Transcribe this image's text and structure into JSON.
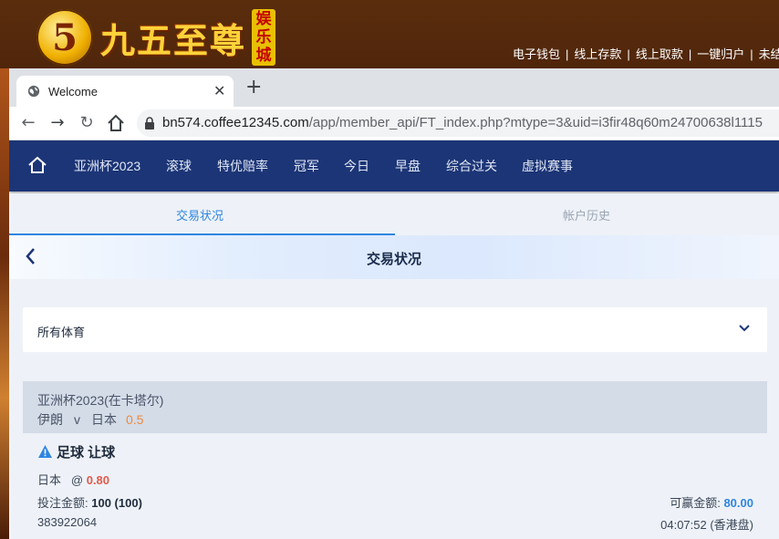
{
  "site": {
    "logo_digit": "5",
    "logo_text": "九五至尊",
    "logo_badge": [
      "娱",
      "乐",
      "城"
    ],
    "top_links": [
      "电子钱包",
      "线上存款",
      "线上取款",
      "一键归户",
      "未结"
    ]
  },
  "browser": {
    "tab_title": "Welcome",
    "url_host": "bn574.coffee12345.com",
    "url_path": "/app/member_api/FT_index.php?mtype=3&uid=i3fir48q60m24700638l1115"
  },
  "nav": {
    "items": [
      "亚洲杯2023",
      "滚球",
      "特优赔率",
      "冠军",
      "今日",
      "早盘",
      "综合过关",
      "虚拟赛事"
    ]
  },
  "subtabs": [
    "交易状况",
    "帐户历史"
  ],
  "page_title": "交易状况",
  "filter": {
    "selected": "所有体育"
  },
  "bet": {
    "league": "亚洲杯2023(在卡塔尔)",
    "home": "伊朗",
    "vs": "v",
    "away": "日本",
    "handicap": "0.5",
    "bet_type": "足球 让球",
    "selection": "日本",
    "at": "@",
    "odds": "0.80",
    "stake_label": "投注金额:",
    "stake_value": "100 (100)",
    "win_label": "可赢金额:",
    "win_value": "80.00",
    "ticket_id": "383922064",
    "time": "04:07:52 (香港盘)"
  },
  "colors": {
    "nav_bg": "#1c3576",
    "accent": "#2f86e0",
    "odds": "#e25a4a",
    "handicap": "#f0883a"
  }
}
